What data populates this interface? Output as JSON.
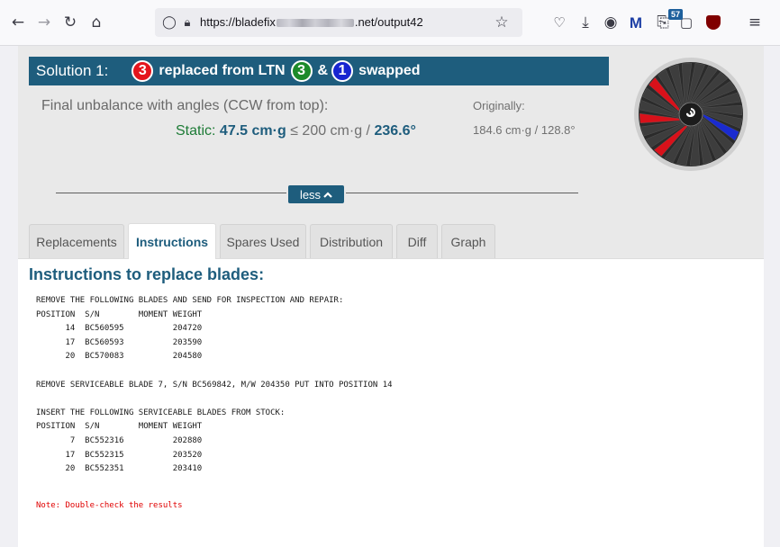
{
  "browser": {
    "url_prefix": "https://bladefix",
    "url_suffix": ".net/output42",
    "badge_count": "57"
  },
  "solution": {
    "title": "Solution 1:",
    "replaced_count": "3",
    "replaced_text": "replaced from LTN",
    "ltn_count": "3",
    "amp": "&",
    "swapped_count": "1",
    "swapped_text": "swapped"
  },
  "unbalance": {
    "label": "Final unbalance with angles (CCW from top):",
    "static_label": "Static:",
    "static_value": "47.5 cm·g",
    "limit": "≤ 200 cm·g /",
    "angle": "236.6°",
    "original_label": "Originally:",
    "original_value": "184.6 cm·g / 128.8°"
  },
  "toggle": {
    "label": "less"
  },
  "tabs": [
    {
      "label": "Replacements"
    },
    {
      "label": "Instructions"
    },
    {
      "label": "Spares Used"
    },
    {
      "label": "Distribution"
    },
    {
      "label": "Diff"
    },
    {
      "label": "Graph"
    }
  ],
  "active_tab": "Instructions",
  "instructions": {
    "title": "Instructions to replace blades:",
    "text": "REMOVE THE FOLLOWING BLADES AND SEND FOR INSPECTION AND REPAIR:\nPOSITION  S/N        MOMENT WEIGHT\n      14  BC560595          204720\n      17  BC560593          203590\n      20  BC570083          204580\n\nREMOVE SERVICEABLE BLADE 7, S/N BC569842, M/W 204350 PUT INTO POSITION 14\n\nINSERT THE FOLLOWING SERVICEABLE BLADES FROM STOCK:\nPOSITION  S/N        MOMENT WEIGHT\n       7  BC552316          202880\n      17  BC552315          203520\n      20  BC552351          203410",
    "note": "Note: Double-check the results"
  },
  "rotor": {
    "blade_count": 24,
    "replaced_positions": [
      14,
      17,
      20
    ],
    "swapped_positions": [
      7
    ],
    "colors": {
      "normal": "#3d3d3d",
      "replaced": "#d8111a",
      "swapped": "#1a2bd0",
      "hub": "#1c1c1c",
      "rim": "#cfcfcf"
    }
  },
  "colors": {
    "accent": "#1e5d7d",
    "static_green": "#1d7b36",
    "note_red": "#e00000"
  }
}
